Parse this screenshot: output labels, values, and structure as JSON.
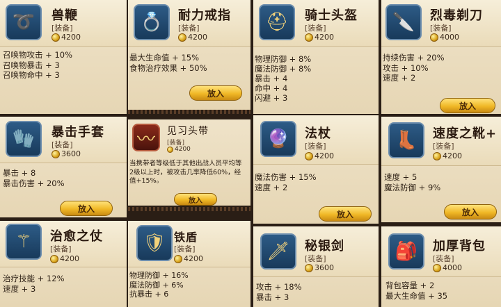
{
  "price_tag": "[装备]",
  "place_label": "放入",
  "items": [
    {
      "name": "兽鞭",
      "icon": "whip-icon",
      "price": "4200",
      "stats": [
        "召唤物攻击 + 10%",
        "召唤物暴击 + 3",
        "召唤物命中 + 3"
      ]
    },
    {
      "name": "耐力戒指",
      "icon": "ring-icon",
      "price": "4200",
      "stats": [
        "最大生命值 + 15%",
        "食物治疗效果 + 50%"
      ]
    },
    {
      "name": "骑士头盔",
      "icon": "helmet-icon",
      "price": "4200",
      "stats": [
        "物理防御 + 8%",
        "魔法防御 + 8%",
        "暴击 + 4",
        "命中 + 4",
        "闪避 + 3"
      ]
    },
    {
      "name": "烈毒剃刀",
      "icon": "dagger-icon",
      "price": "4000",
      "stats": [
        "持续伤害 + 20%",
        "攻击 + 10%",
        "速度 + 2"
      ]
    },
    {
      "name": "暴击手套",
      "icon": "glove-icon",
      "price": "3600",
      "stats": [
        "暴击 + 8",
        "暴击伤害 + 20%"
      ]
    },
    {
      "name": "见习头带",
      "icon": "headband-icon",
      "price": "4200",
      "stats": [
        "当携带者等级低于其他出战人员平均等",
        "2级以上时，被攻击几率降低60%，经",
        "值+15%。"
      ]
    },
    {
      "name": "法杖",
      "icon": "staff-icon",
      "price": "4200",
      "stats": [
        "魔法伤害 + 15%",
        "速度 + 2"
      ]
    },
    {
      "name": "速度之靴+",
      "icon": "boots-icon",
      "price": "4200",
      "stats": [
        "速度 + 5",
        "魔法防御 + 9%"
      ]
    },
    {
      "name": "治愈之仗",
      "icon": "heal-staff-icon",
      "price": "4200",
      "stats": [
        "治疗技能 + 12%",
        "速度 + 3"
      ]
    },
    {
      "name": "铁盾",
      "icon": "shield-icon",
      "price": "4200",
      "stats": [
        "物理防御 + 16%",
        "魔法防御 + 6%",
        "抗暴击 + 6"
      ]
    },
    {
      "name": "秘银剑",
      "icon": "sword-icon",
      "price": "3600",
      "stats": [
        "攻击 + 18%",
        "暴击 + 3"
      ]
    },
    {
      "name": "加厚背包",
      "icon": "backpack-icon",
      "price": "4000",
      "stats": [
        "背包容量 + 2",
        "最大生命值 + 35"
      ]
    }
  ]
}
